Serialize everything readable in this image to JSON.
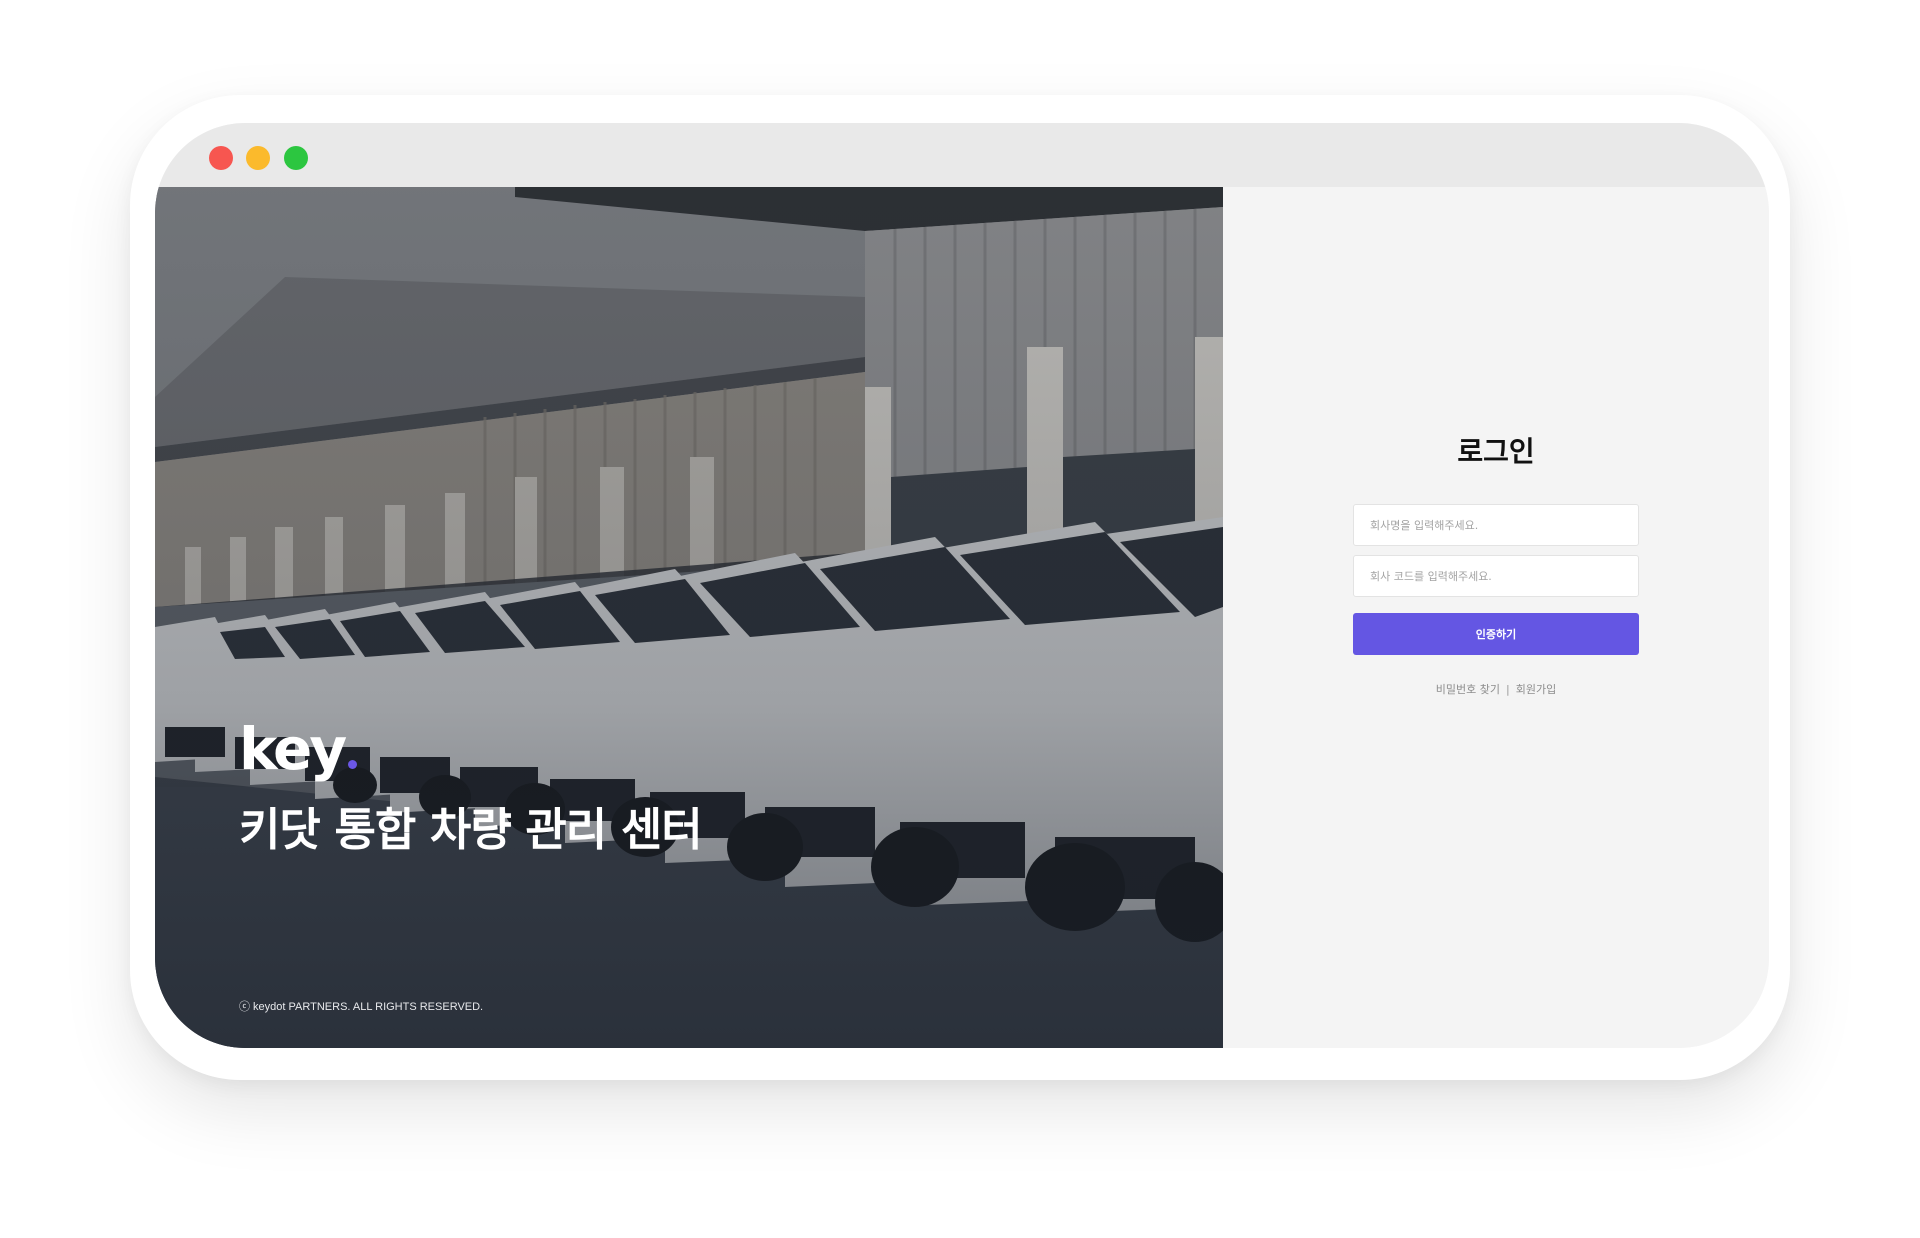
{
  "window": {
    "controls": [
      "close",
      "minimize",
      "maximize"
    ]
  },
  "hero": {
    "logo_text": "key",
    "title": "키닷 통합 차량 관리 센터",
    "copyright": "ⓒ keydot PARTNERS. ALL RIGHTS RESERVED."
  },
  "login": {
    "title": "로그인",
    "company_name_placeholder": "회사명을 입력해주세요.",
    "company_code_placeholder": "회사 코드를 입력해주세요.",
    "submit_label": "인증하기",
    "find_password_label": "비밀번호 찾기",
    "separator": "|",
    "signup_label": "회원가입"
  },
  "colors": {
    "accent": "#6456e3",
    "logo_dot": "#6b57e6",
    "close": "#f75650",
    "minimize": "#fbba2c",
    "maximize": "#2cc640"
  }
}
